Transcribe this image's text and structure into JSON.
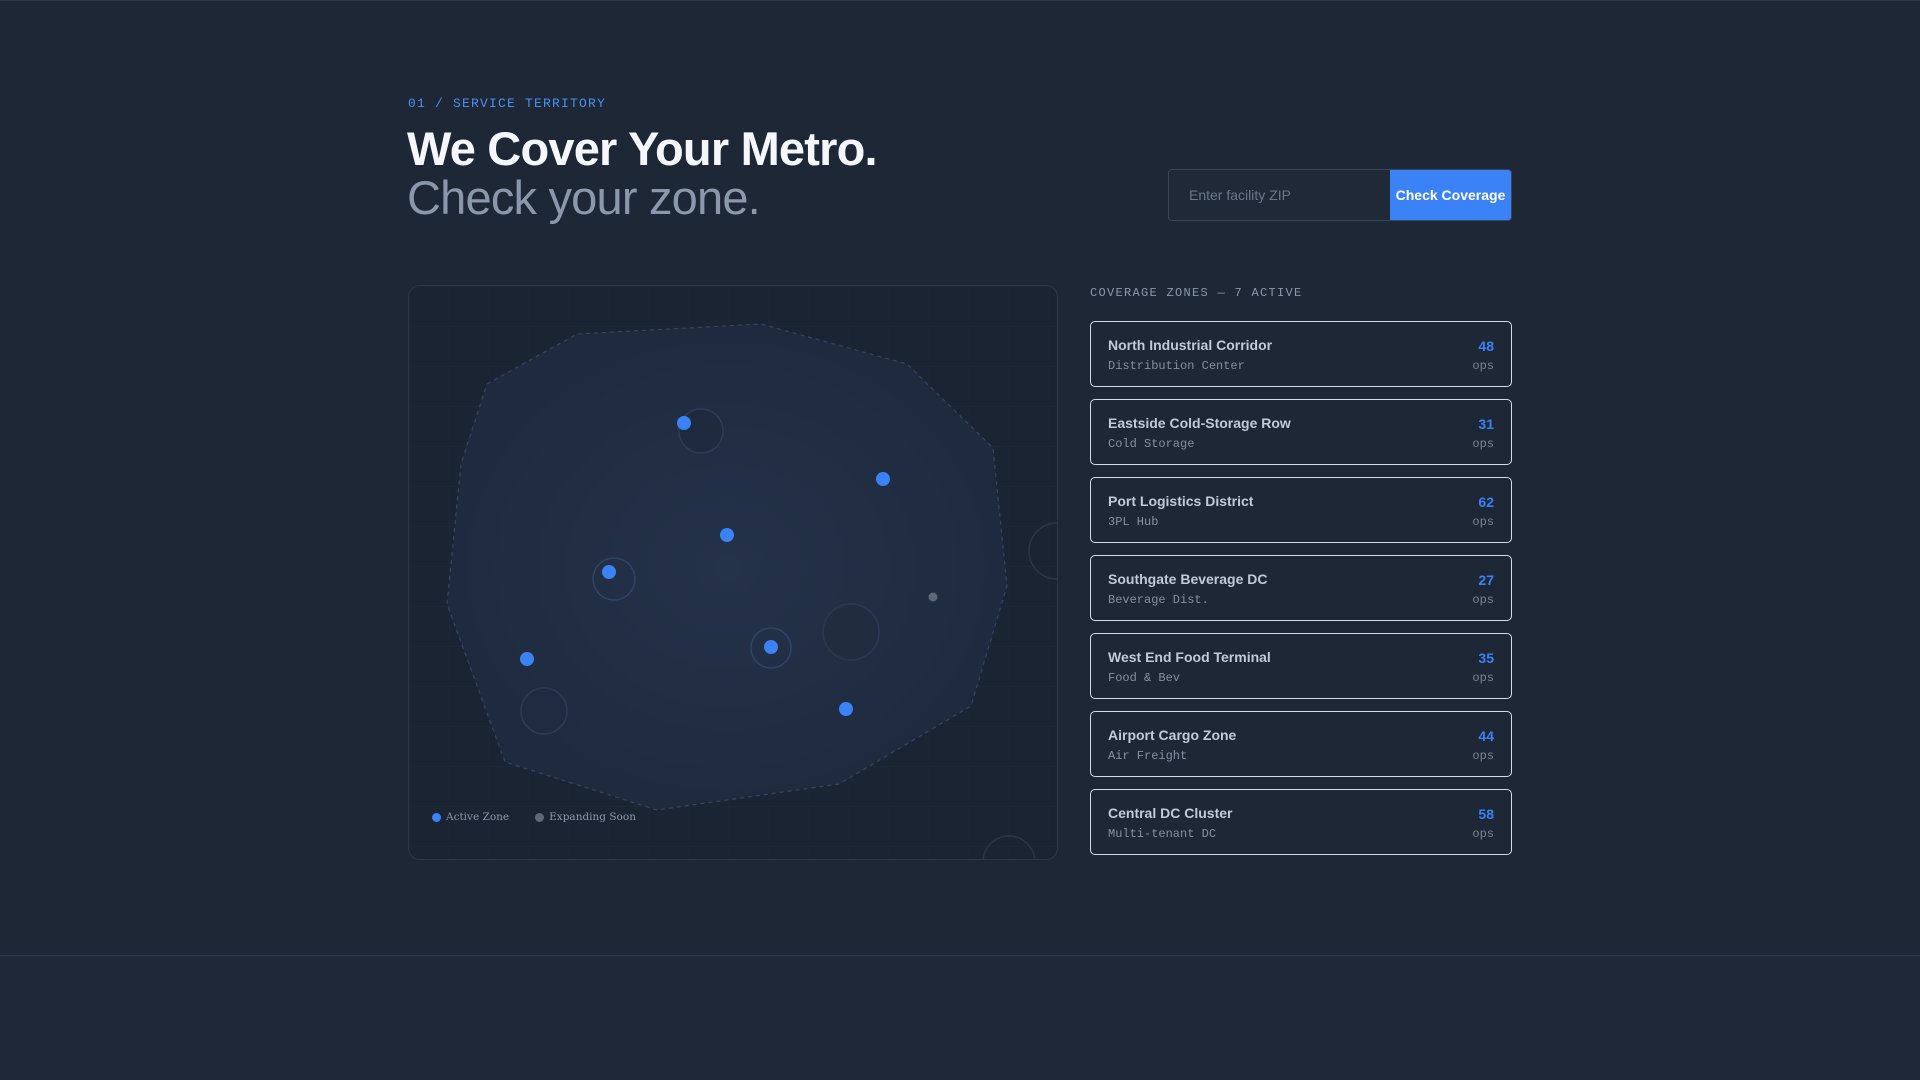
{
  "header": {
    "eyebrow": "01 / SERVICE TERRITORY",
    "title": "We Cover Your Metro.",
    "subtitle": "Check your zone."
  },
  "search": {
    "placeholder": "Enter facility ZIP",
    "value": "",
    "button_label": "Check Coverage",
    "button_color": "#3b82f6"
  },
  "map": {
    "legend": {
      "active_label": "Active Zone",
      "soon_label": "Expanding Soon"
    },
    "colors": {
      "active": "#3b82f6",
      "soon": "#5f6878"
    }
  },
  "zones": {
    "heading": "COVERAGE ZONES — 7 ACTIVE",
    "items": [
      {
        "name": "North Industrial Corridor",
        "type": "Distribution Center",
        "count": "48",
        "unit": "ops"
      },
      {
        "name": "Eastside Cold-Storage Row",
        "type": "Cold Storage",
        "count": "31",
        "unit": "ops"
      },
      {
        "name": "Port Logistics District",
        "type": "3PL Hub",
        "count": "62",
        "unit": "ops"
      },
      {
        "name": "Southgate Beverage DC",
        "type": "Beverage Dist.",
        "count": "27",
        "unit": "ops"
      },
      {
        "name": "West End Food Terminal",
        "type": "Food & Bev",
        "count": "35",
        "unit": "ops"
      },
      {
        "name": "Airport Cargo Zone",
        "type": "Air Freight",
        "count": "44",
        "unit": "ops"
      },
      {
        "name": "Central DC Cluster",
        "type": "Multi-tenant DC",
        "count": "58",
        "unit": "ops"
      }
    ]
  }
}
